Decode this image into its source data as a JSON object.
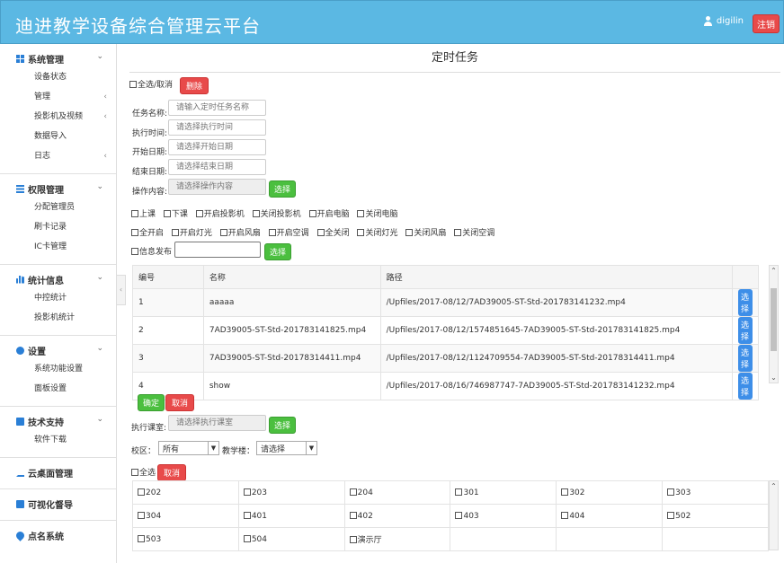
{
  "header": {
    "title": "迪进教学设备综合管理云平台",
    "username": "digilin",
    "logout_label": "注销"
  },
  "sidebar": {
    "groups": [
      {
        "label": "系统管理",
        "items": [
          {
            "label": "设备状态"
          },
          {
            "label": "管理"
          },
          {
            "label": "投影机及视频"
          },
          {
            "label": "数据导入"
          },
          {
            "label": "日志"
          }
        ]
      },
      {
        "label": "权限管理",
        "items": [
          {
            "label": "分配管理员"
          },
          {
            "label": "刷卡记录"
          },
          {
            "label": "IC卡管理"
          }
        ]
      },
      {
        "label": "统计信息",
        "items": [
          {
            "label": "中控统计"
          },
          {
            "label": "投影机统计"
          }
        ]
      },
      {
        "label": "设置",
        "items": [
          {
            "label": "系统功能设置"
          },
          {
            "label": "面板设置"
          }
        ]
      },
      {
        "label": "技术支持",
        "items": [
          {
            "label": "软件下载"
          }
        ]
      },
      {
        "label": "云桌面管理",
        "items": []
      },
      {
        "label": "可视化督导",
        "items": []
      },
      {
        "label": "点名系统",
        "items": []
      }
    ]
  },
  "main": {
    "page_title": "定时任务",
    "select_all_label": "全选/取消",
    "delete_label": "删除",
    "form": {
      "task_name_label": "任务名称:",
      "task_name_placeholder": "请输入定时任务名称",
      "exec_time_label": "执行时间:",
      "exec_time_placeholder": "请选择执行时间",
      "start_date_label": "开始日期:",
      "start_date_placeholder": "请选择开始日期",
      "end_date_label": "结束日期:",
      "end_date_placeholder": "请选择结束日期",
      "operation_label": "操作内容:",
      "operation_placeholder": "请选择操作内容",
      "select_label": "选择"
    },
    "operations_row1": [
      "上课",
      "下课",
      "开启投影机",
      "关闭投影机",
      "开启电脑",
      "关闭电脑"
    ],
    "operations_row2": [
      "全开启",
      "开启灯光",
      "开启风扇",
      "开启空调",
      "全关闭",
      "关闭灯光",
      "关闭风扇",
      "关闭空调"
    ],
    "info_publish_label": "信息发布",
    "info_select_label": "选择",
    "table": {
      "headers": [
        "编号",
        "名称",
        "路径"
      ],
      "rows": [
        {
          "no": "1",
          "name": "aaaaa",
          "path": "/Upfiles/2017-08/12/7AD39005-ST-Std-201783141232.mp4",
          "action": "选择"
        },
        {
          "no": "2",
          "name": "7AD39005-ST-Std-201783141825.mp4",
          "path": "/Upfiles/2017-08/12/1574851645-7AD39005-ST-Std-201783141825.mp4",
          "action": "选择"
        },
        {
          "no": "3",
          "name": "7AD39005-ST-Std-20178314411.mp4",
          "path": "/Upfiles/2017-08/12/1124709554-7AD39005-ST-Std-20178314411.mp4",
          "action": "选择"
        },
        {
          "no": "4",
          "name": "show",
          "path": "/Upfiles/2017-08/16/746987747-7AD39005-ST-Std-201783141232.mp4",
          "action": "选择"
        }
      ]
    },
    "confirm_label": "确定",
    "cancel_label": "取消",
    "classroom_label": "执行课室:",
    "classroom_placeholder": "请选择执行课室",
    "classroom_select_label": "选择",
    "campus_label": "校区：",
    "campus_value": "所有",
    "building_label": "教学楼：",
    "building_value": "请选择",
    "select_all_rooms_label": "全选",
    "rooms_cancel_label": "取消",
    "rooms": [
      [
        "202",
        "203",
        "204",
        "301",
        "302",
        "303"
      ],
      [
        "304",
        "401",
        "402",
        "403",
        "404",
        "502"
      ],
      [
        "503",
        "504",
        "演示厅",
        "",
        "",
        ""
      ]
    ]
  }
}
